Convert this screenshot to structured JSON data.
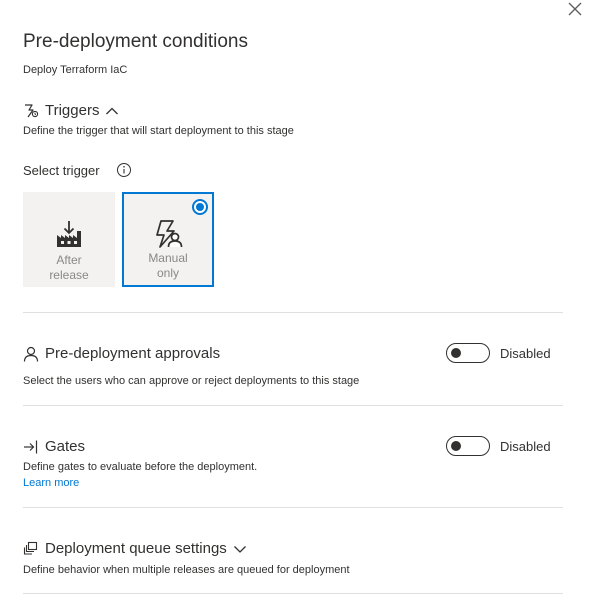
{
  "panel": {
    "title": "Pre-deployment conditions",
    "subtitle": "Deploy Terraform IaC",
    "close_icon": "close-icon"
  },
  "triggers": {
    "title": "Triggers",
    "icon": "trigger-icon",
    "expanded": true,
    "description": "Define the trigger that will start deployment to this stage",
    "select_label": "Select trigger",
    "info_icon": "info-icon",
    "options": [
      {
        "label_line1": "After",
        "label_line2": "release",
        "icon": "after-release-icon",
        "selected": false
      },
      {
        "label_line1": "Manual",
        "label_line2": "only",
        "icon": "manual-only-icon",
        "selected": true
      }
    ]
  },
  "approvals": {
    "title": "Pre-deployment approvals",
    "icon": "person-icon",
    "description": "Select the users who can approve or reject deployments to this stage",
    "toggle_state": "Disabled",
    "enabled": false
  },
  "gates": {
    "title": "Gates",
    "icon": "gates-icon",
    "description": "Define gates to evaluate before the deployment.",
    "learn_more": "Learn more",
    "toggle_state": "Disabled",
    "enabled": false
  },
  "queue": {
    "title": "Deployment queue settings",
    "icon": "queue-icon",
    "expanded": false,
    "description": "Define behavior when multiple releases are queued for deployment"
  },
  "colors": {
    "accent": "#0078d4",
    "text": "#323130",
    "muted": "#8a8886",
    "card_bg": "#f3f2f1",
    "divider": "#e1dfdd"
  }
}
